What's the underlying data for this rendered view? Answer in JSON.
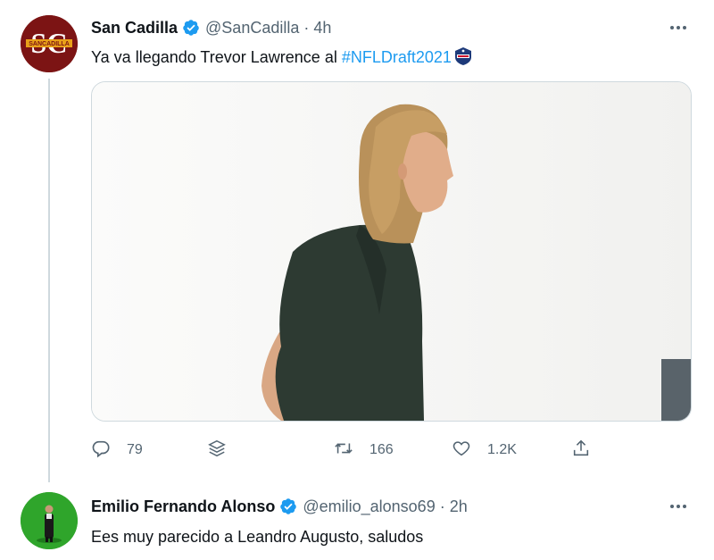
{
  "tweets": [
    {
      "author_name": "San Cadilla",
      "handle": "@SanCadilla",
      "separator": "·",
      "time": "4h",
      "avatar_logo_text": "SC",
      "avatar_logo_subtext": "SANCADILLA",
      "text_prefix": "Ya va llegando Trevor Lawrence al ",
      "hashtag": "#NFLDraft2021",
      "media_image": "photo of a long-haired man in a dark green shirt against a white wall",
      "actions": {
        "reply_count": "79",
        "retweet_count": "166",
        "like_count": "1.2K"
      }
    },
    {
      "author_name": "Emilio Fernando Alonso",
      "handle": "@emilio_alonso69",
      "separator": "·",
      "time": "2h",
      "text": "Ees muy parecido a Leandro Augusto, saludos"
    }
  ],
  "icons": {
    "verified": "verified-badge-icon",
    "more": "more-options-icon",
    "reply": "reply-icon",
    "stack": "layers-icon",
    "retweet": "retweet-icon",
    "like": "like-icon",
    "share": "share-icon"
  },
  "colors": {
    "link": "#1d9bf0",
    "muted": "#536471",
    "text": "#0f1419",
    "border": "#cfd9de",
    "brand_red": "#7c1414",
    "avatar_green": "#2fa52b"
  }
}
